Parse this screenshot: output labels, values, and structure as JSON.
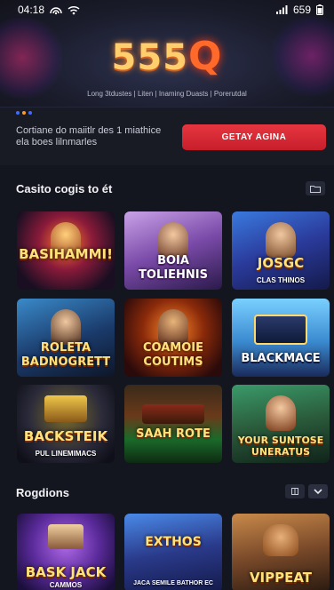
{
  "status_bar": {
    "time": "04:18",
    "battery": "659"
  },
  "hero": {
    "logo_number": "555",
    "logo_letter": "Q",
    "links": "Long 3tdustes | Liten | Inaming Duasts | Porerutdal"
  },
  "promo": {
    "text": "Cortiane do maiitlr des 1 miathice ela boes lilnmarles",
    "cta_label": "GETAY AGINA"
  },
  "section1": {
    "title": "Casito cogis to ét"
  },
  "tiles1": [
    {
      "label": "BASIHAMMI!",
      "sub": ""
    },
    {
      "label": "BOIA TOLIEHNIS",
      "sub": ""
    },
    {
      "label": "JOSGC",
      "sub": "CLAS THINOS"
    },
    {
      "label": "ROLETA BADNOGRETT",
      "sub": ""
    },
    {
      "label": "COAMOIE COUTIMS",
      "sub": ""
    },
    {
      "label": "BLACKMACE",
      "sub": ""
    },
    {
      "label": "BACKSTEIK",
      "sub": "PUL LINEMIMACS"
    },
    {
      "label": "SAAH ROTE",
      "sub": ""
    },
    {
      "label": "YOUR SUNTOSE UNERATUS",
      "sub": ""
    }
  ],
  "section2": {
    "title": "Rogdions"
  },
  "tiles2": [
    {
      "label": "BASK JACK",
      "sub": "CAMMOS"
    },
    {
      "label": "EXTHOS",
      "sub": "JACA SEMILE BATHOR EC"
    },
    {
      "label": "VIPPEAT",
      "sub": ""
    }
  ],
  "colors": {
    "accent": "#e63640",
    "background": "#14161f",
    "gold": "#ffe27a"
  }
}
